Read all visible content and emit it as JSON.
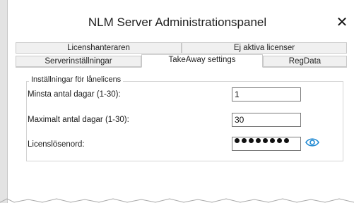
{
  "window": {
    "title": "NLM Server Administrationspanel",
    "close_glyph": "✕"
  },
  "tabs": {
    "row1": [
      {
        "label": "Licenshanteraren"
      },
      {
        "label": "Ej aktiva licenser"
      }
    ],
    "row2": [
      {
        "label": "Serverinställningar"
      },
      {
        "label": "TakeAway settings",
        "active": true
      },
      {
        "label": "RegData"
      }
    ]
  },
  "group": {
    "legend": "Inställningar för lånelicens",
    "min_days_label": "Minsta antal dagar (1-30):",
    "min_days_value": "1",
    "max_days_label": "Maximalt antal dagar (1-30):",
    "max_days_value": "30",
    "password_label": "Licenslösenord:",
    "password_dots": 8
  },
  "icons": {
    "close": "close-icon",
    "reveal": "eye-icon"
  },
  "colors": {
    "accent": "#1e88d2",
    "tab_inactive": "#f0f0f0",
    "border": "#c9c9c9"
  }
}
